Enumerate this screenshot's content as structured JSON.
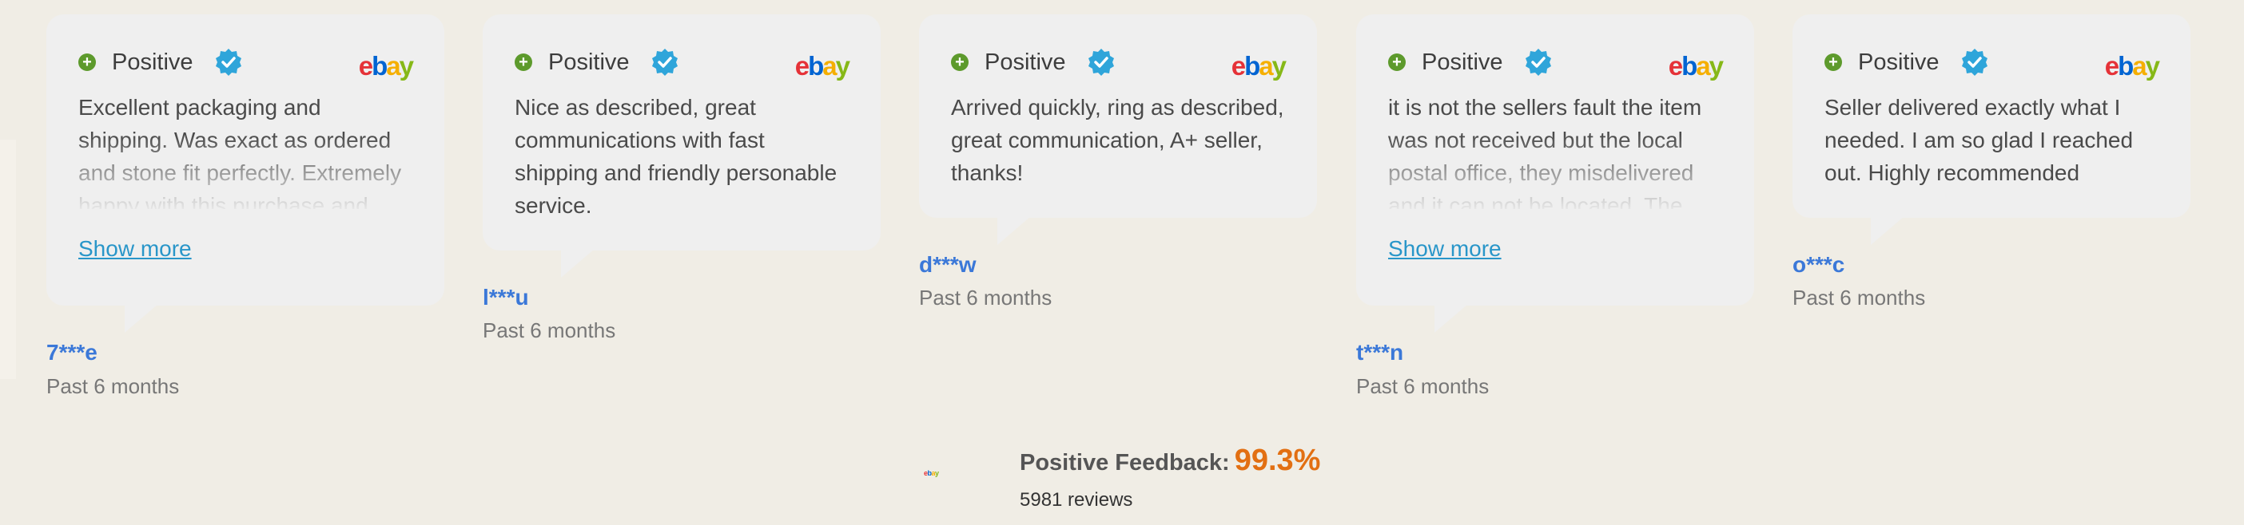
{
  "cards": [
    {
      "sentiment": "Positive",
      "logo": "ebay",
      "text": "Excellent packaging and shipping. Was exact as ordered and stone fit perfectly. Extremely happy with this purchase and...",
      "show_more": "Show more",
      "user": "7***e",
      "when": "Past 6 months"
    },
    {
      "sentiment": "Positive",
      "logo": "ebay",
      "text": "Nice as described, great communications with fast shipping and friendly personable service.",
      "user": "l***u",
      "when": "Past 6 months"
    },
    {
      "sentiment": "Positive",
      "logo": "ebay",
      "text": "Arrived quickly, ring as described, great communication, A+ seller, thanks!",
      "user": "d***w",
      "when": "Past 6 months"
    },
    {
      "sentiment": "Positive",
      "logo": "ebay",
      "text": "it is not the sellers fault the item was not received but the local postal office, they misdelivered and it can not be located. The...",
      "show_more": "Show more",
      "user": "t***n",
      "when": "Past 6 months"
    },
    {
      "sentiment": "Positive",
      "logo": "ebay",
      "text": "Seller delivered exactly what I needed. I am so glad I reached out. Highly recommended",
      "user": "o***c",
      "when": "Past 6 months"
    }
  ],
  "summary": {
    "label": "Positive Feedback:",
    "percent": "99.3%",
    "reviews": "5981 reviews",
    "mini_logo": "ebay"
  },
  "colors": {
    "background": "#f0ede5",
    "card": "#efefef",
    "positive_icon": "#5d9a2c",
    "verified_icon": "#2fa5da",
    "link": "#2996c9",
    "username": "#3b78d8",
    "percent": "#e26f12"
  },
  "icons": {
    "positive": "plus-circle-icon",
    "verified": "verified-badge-icon"
  }
}
